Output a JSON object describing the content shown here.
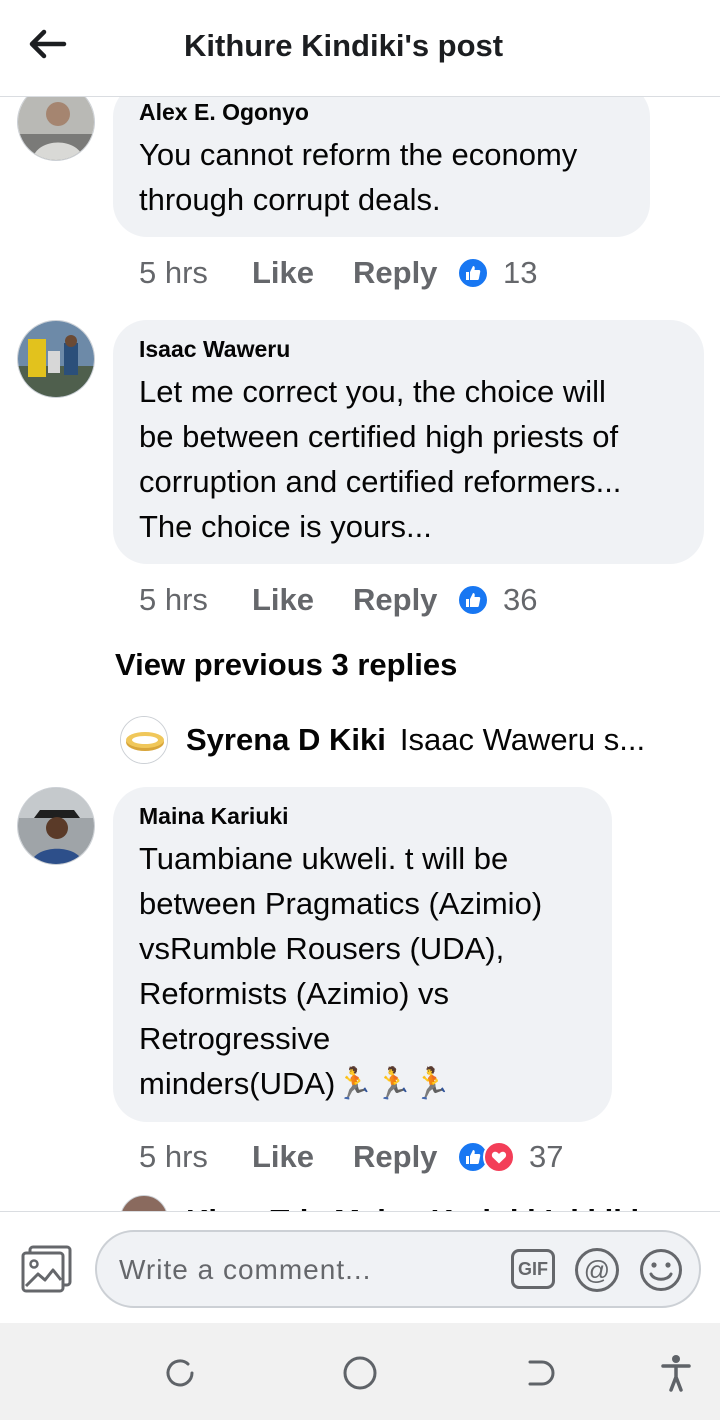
{
  "header": {
    "title": "Kithure Kindiki's post"
  },
  "comments": [
    {
      "author": "Alex E. Ogonyo",
      "text_lines": [
        "You cannot reform the economy",
        "through corrupt deals."
      ],
      "time": "5 hrs",
      "like": "Like",
      "reply": "Reply",
      "reaction_count": "13",
      "reactions": [
        "like"
      ]
    },
    {
      "author": "Isaac Waweru",
      "text_lines": [
        "Let me correct you, the choice will",
        "be between certified high priests of",
        "corruption and certified reformers...",
        "The choice is yours..."
      ],
      "time": "5 hrs",
      "like": "Like",
      "reply": "Reply",
      "reaction_count": "36",
      "reactions": [
        "like"
      ]
    },
    {
      "author": "Maina Kariuki",
      "text_lines": [
        "Tuambiane ukweli. t will be",
        "between Pragmatics (Azimio)",
        "vsRumble Rousers (UDA),",
        "Reformists (Azimio) vs",
        "Retrogressive",
        "minders(UDA)🏃🏃🏃"
      ],
      "time": "5 hrs",
      "like": "Like",
      "reply": "Reply",
      "reaction_count": "37",
      "reactions": [
        "like",
        "love"
      ]
    }
  ],
  "view_previous": "View previous 3 replies",
  "reply_preview": {
    "name": "Syrena D Kiki",
    "text": "Isaac Waweru s..."
  },
  "peek_line": "Kiam Tric Maina Kariuki Isi kiki",
  "composer": {
    "placeholder": "Write a comment...",
    "gif_label": "GIF",
    "at_label": "@"
  },
  "icons": [
    "back-arrow-icon",
    "thumbs-up-icon",
    "heart-icon",
    "photo-icon",
    "gif-icon",
    "mention-icon",
    "emoji-icon",
    "recent-apps-icon",
    "home-icon",
    "back-icon",
    "accessibility-icon"
  ],
  "colors": {
    "accent": "#1877f2",
    "love": "#f33e58",
    "bubble": "#f0f2f5",
    "muted": "#65676b"
  }
}
